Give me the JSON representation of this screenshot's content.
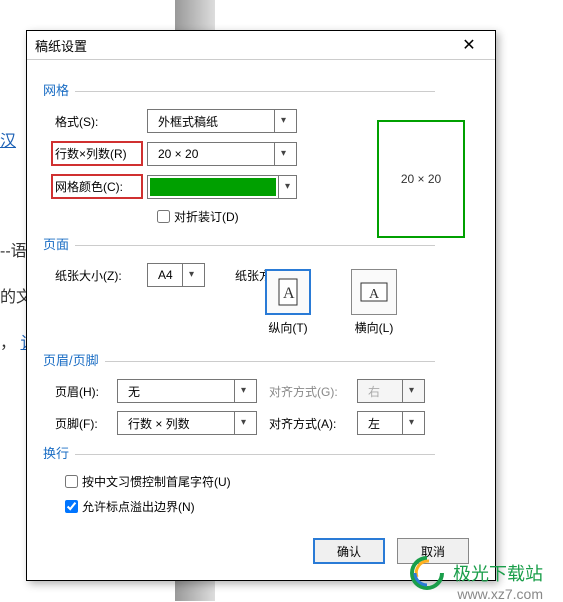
{
  "bgtext": {
    "l1": "汉",
    "l2": "--语",
    "l3": "的文",
    "l4": "， 讨"
  },
  "dialog": {
    "title": "稿纸设置"
  },
  "grid": {
    "section": "网格",
    "format_label": "格式(S):",
    "format_value": "外框式稿纸",
    "rowscols_label": "行数×列数(R)",
    "rowscols_value": "20 × 20",
    "color_label": "网格颜色(C):",
    "binding_label": "对折装订(D)",
    "preview_text": "20 × 20"
  },
  "page": {
    "section": "页面",
    "size_label": "纸张大小(Z):",
    "size_value": "A4",
    "orient_label": "纸张方向:",
    "portrait": "纵向(T)",
    "landscape": "横向(L)"
  },
  "hf": {
    "section": "页眉/页脚",
    "header_label": "页眉(H):",
    "header_value": "无",
    "header_align_label": "对齐方式(G):",
    "header_align_value": "右",
    "footer_label": "页脚(F):",
    "footer_value": "行数 × 列数",
    "footer_align_label": "对齐方式(A):",
    "footer_align_value": "左"
  },
  "wrap": {
    "section": "换行",
    "cb1": "按中文习惯控制首尾字符(U)",
    "cb2": "允许标点溢出边界(N)"
  },
  "buttons": {
    "ok": "确认",
    "cancel": "取消"
  },
  "watermark": {
    "text": "极光下载站",
    "url": "www.xz7.com"
  }
}
